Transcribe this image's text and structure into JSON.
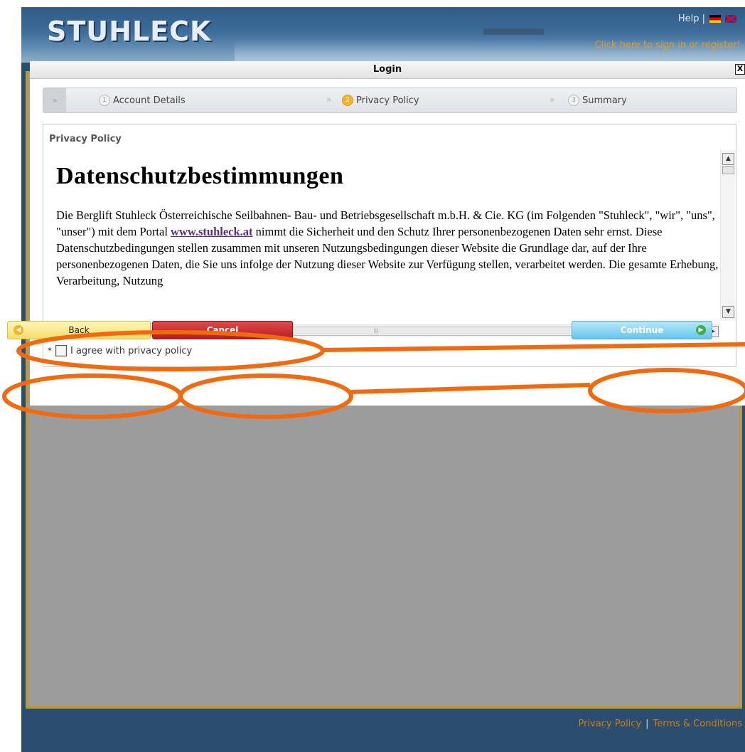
{
  "site": {
    "logo": "STUHLECK",
    "help": "Help |",
    "signin": "Click here to sign in or register!"
  },
  "dialog": {
    "title": "Login",
    "close": "X"
  },
  "steps": [
    {
      "number": "1",
      "label": "Account Details"
    },
    {
      "number": "2",
      "label": "Privacy Policy"
    },
    {
      "number": "3",
      "label": "Summary"
    }
  ],
  "policy": {
    "label": "Privacy Policy",
    "heading": "Datenschutzbestimmungen",
    "text_before_link": "Die Berglift Stuhleck Österreichische Seilbahnen- Bau- und Betriebsgesellschaft m.b.H. & Cie. KG  (im Folgenden \"Stuhleck\", \"wir\", \"uns\", \"unser\") mit dem Portal ",
    "link": "www.stuhleck.at",
    "text_after_link": " nimmt die Sicherheit und den Schutz Ihrer personenbezogenen Daten sehr ernst. Diese Datenschutzbedingungen stellen zusammen mit unseren Nutzungsbedingungen dieser Website die Grundlage dar, auf der Ihre personenbezogenen Daten, die Sie uns infolge der Nutzung dieser Website zur Verfügung stellen, verarbeitet werden. Die gesamte Erhebung, Verarbeitung, Nutzung"
  },
  "agree": {
    "required": "*",
    "label": "I agree with privacy policy",
    "checked": false
  },
  "buttons": {
    "back": "Back",
    "cancel": "Cancel",
    "continue": "Continue"
  },
  "footer": {
    "privacy": "Privacy Policy",
    "terms": "Terms & Conditions"
  },
  "colors": {
    "annotation": "#f26a10",
    "frame_border": "#b89a3a",
    "overlay_gray": "#9c9c9c"
  }
}
